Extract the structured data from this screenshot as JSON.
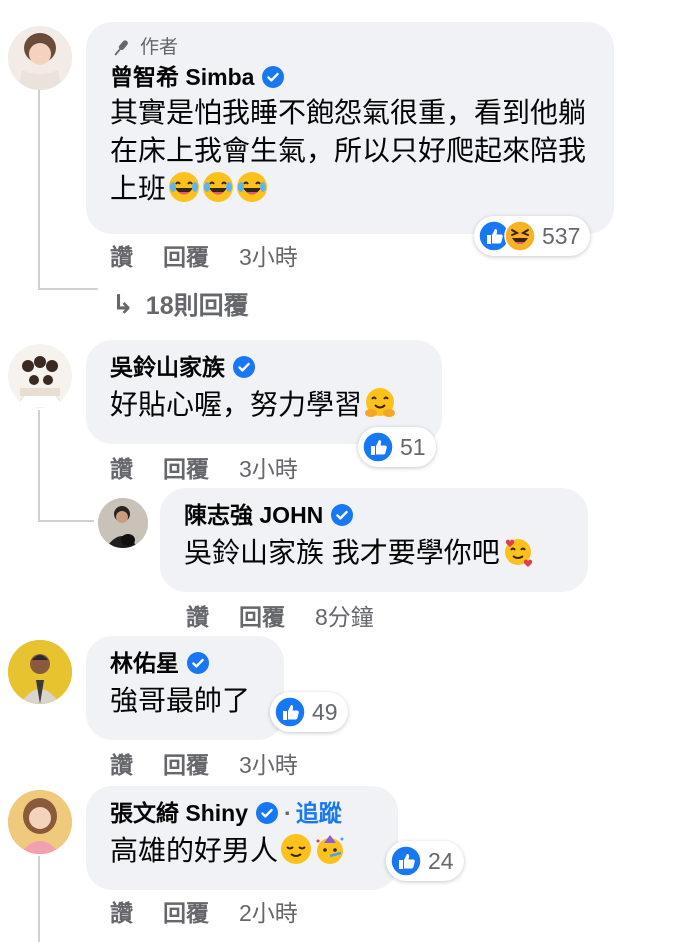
{
  "comments": [
    {
      "author_tag": "作者",
      "name": "曾智希 Simba",
      "text": "其實是怕我睡不飽怨氣很重，看到他躺在床上我會生氣，所以只好爬起來陪我上班",
      "emojis": [
        "laughing-tears-emoji",
        "laughing-tears-emoji",
        "laughing-tears-emoji"
      ],
      "reactions": {
        "count": "537",
        "types": [
          "like-icon",
          "haha-icon"
        ]
      },
      "actions": {
        "like": "讚",
        "reply": "回覆",
        "time": "3小時"
      },
      "more_replies": "18則回覆"
    },
    {
      "name": "吳鈴山家族",
      "text": "好貼心喔，努力學習",
      "emojis": [
        "hugging-emoji"
      ],
      "reactions": {
        "count": "51",
        "types": [
          "like-icon"
        ]
      },
      "actions": {
        "like": "讚",
        "reply": "回覆",
        "time": "3小時"
      },
      "reply": {
        "name": "陳志強 JOHN",
        "text": "吳鈴山家族 我才要學你吧",
        "emojis": [
          "smiling-hearts-emoji"
        ],
        "actions": {
          "like": "讚",
          "reply": "回覆",
          "time": "8分鐘"
        }
      }
    },
    {
      "name": "林佑星",
      "text": "強哥最帥了",
      "reactions": {
        "count": "49",
        "types": [
          "like-icon"
        ]
      },
      "actions": {
        "like": "讚",
        "reply": "回覆",
        "time": "3小時"
      }
    },
    {
      "name": "張文綺 Shiny",
      "follow": "追蹤",
      "text": "高雄的好男人",
      "emojis": [
        "relieved-emoji",
        "party-face-emoji"
      ],
      "reactions": {
        "count": "24",
        "types": [
          "like-icon"
        ]
      },
      "actions": {
        "like": "讚",
        "reply": "回覆",
        "time": "2小時"
      }
    }
  ],
  "colors": {
    "bubble": "#f0f2f5",
    "verified": "#1877f2",
    "meta": "#65676b",
    "link": "#1877f2"
  }
}
